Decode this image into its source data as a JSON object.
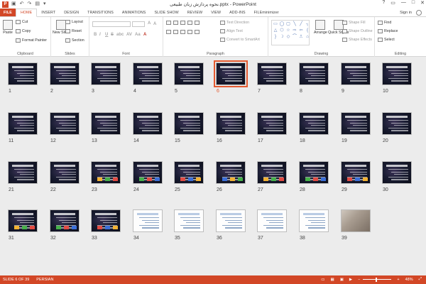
{
  "window": {
    "title": "نحوه پردازش زبان طبیعی.pptx - PowerPoint",
    "app_icon_letter": "P",
    "controls": [
      "?",
      "▭",
      "—",
      "□",
      "✕"
    ],
    "qat_icons": [
      "save-icon",
      "undo-icon",
      "redo-icon",
      "start-from-beginning-icon",
      "customize-icon"
    ]
  },
  "tabs": [
    "FILE",
    "HOME",
    "INSERT",
    "DESIGN",
    "TRANSITIONS",
    "ANIMATIONS",
    "SLIDE SHOW",
    "REVIEW",
    "VIEW",
    "ADD-INS",
    "FILEminimizer"
  ],
  "active_tab": "HOME",
  "signin": "Sign in",
  "ribbon": {
    "clipboard": {
      "label": "Clipboard",
      "paste": "Paste",
      "cut": "Cut",
      "copy": "Copy",
      "format_painter": "Format Painter"
    },
    "slides": {
      "label": "Slides",
      "new_slide": "New Slide",
      "layout": "Layout",
      "reset": "Reset",
      "section": "Section"
    },
    "font": {
      "label": "Font",
      "bold": "B",
      "italic": "I",
      "underline": "U",
      "strike": "S",
      "shadow": "abc",
      "spacing": "AV",
      "case": "Aa",
      "color": "A"
    },
    "paragraph": {
      "label": "Paragraph",
      "text_direction": "Text Direction",
      "align_text": "Align Text",
      "convert_smartart": "Convert to SmartArt"
    },
    "drawing": {
      "label": "Drawing",
      "arrange": "Arrange",
      "quick_styles": "Quick Styles",
      "shape_fill": "Shape Fill",
      "shape_outline": "Shape Outline",
      "shape_effects": "Shape Effects",
      "shapes": [
        "▭",
        "◯",
        "▢",
        "╲",
        "╱",
        "┐",
        "△",
        "⬡",
        "☆",
        "⇨",
        "⇦",
        "{",
        "}",
        "☽",
        "◇",
        "⌒",
        "⎍",
        "⌂"
      ]
    },
    "editing": {
      "label": "Editing",
      "find": "Find",
      "replace": "Replace",
      "select": "Select"
    }
  },
  "slides": [
    {
      "n": "1",
      "kind": "dark"
    },
    {
      "n": "2",
      "kind": "dark"
    },
    {
      "n": "3",
      "kind": "dark"
    },
    {
      "n": "4",
      "kind": "dark"
    },
    {
      "n": "5",
      "kind": "dark"
    },
    {
      "n": "6",
      "kind": "dark",
      "selected": true
    },
    {
      "n": "7",
      "kind": "dark"
    },
    {
      "n": "8",
      "kind": "dark"
    },
    {
      "n": "9",
      "kind": "dark"
    },
    {
      "n": "10",
      "kind": "dark"
    },
    {
      "n": "11",
      "kind": "dark"
    },
    {
      "n": "12",
      "kind": "dark"
    },
    {
      "n": "13",
      "kind": "dark"
    },
    {
      "n": "14",
      "kind": "dark"
    },
    {
      "n": "15",
      "kind": "dark"
    },
    {
      "n": "16",
      "kind": "dark"
    },
    {
      "n": "17",
      "kind": "dark"
    },
    {
      "n": "18",
      "kind": "dark"
    },
    {
      "n": "19",
      "kind": "dark"
    },
    {
      "n": "20",
      "kind": "dark"
    },
    {
      "n": "21",
      "kind": "dark"
    },
    {
      "n": "22",
      "kind": "dark"
    },
    {
      "n": "23",
      "kind": "dark",
      "boxes": true
    },
    {
      "n": "24",
      "kind": "dark",
      "boxes": true
    },
    {
      "n": "25",
      "kind": "dark",
      "boxes": true
    },
    {
      "n": "26",
      "kind": "dark",
      "boxes": true
    },
    {
      "n": "27",
      "kind": "dark",
      "boxes": true
    },
    {
      "n": "28",
      "kind": "dark",
      "boxes": true
    },
    {
      "n": "29",
      "kind": "dark",
      "boxes": true
    },
    {
      "n": "30",
      "kind": "dark"
    },
    {
      "n": "31",
      "kind": "dark",
      "boxes": true
    },
    {
      "n": "32",
      "kind": "dark",
      "boxes": true
    },
    {
      "n": "33",
      "kind": "dark",
      "boxes": true
    },
    {
      "n": "34",
      "kind": "light"
    },
    {
      "n": "35",
      "kind": "light"
    },
    {
      "n": "36",
      "kind": "light"
    },
    {
      "n": "37",
      "kind": "light"
    },
    {
      "n": "38",
      "kind": "light"
    },
    {
      "n": "39",
      "kind": "photo"
    }
  ],
  "status": {
    "slide_info": "SLIDE 6 OF 39",
    "language": "PERSIAN",
    "zoom": "48%"
  },
  "colors": {
    "accent": "#d24726",
    "selection": "#e35a30"
  }
}
